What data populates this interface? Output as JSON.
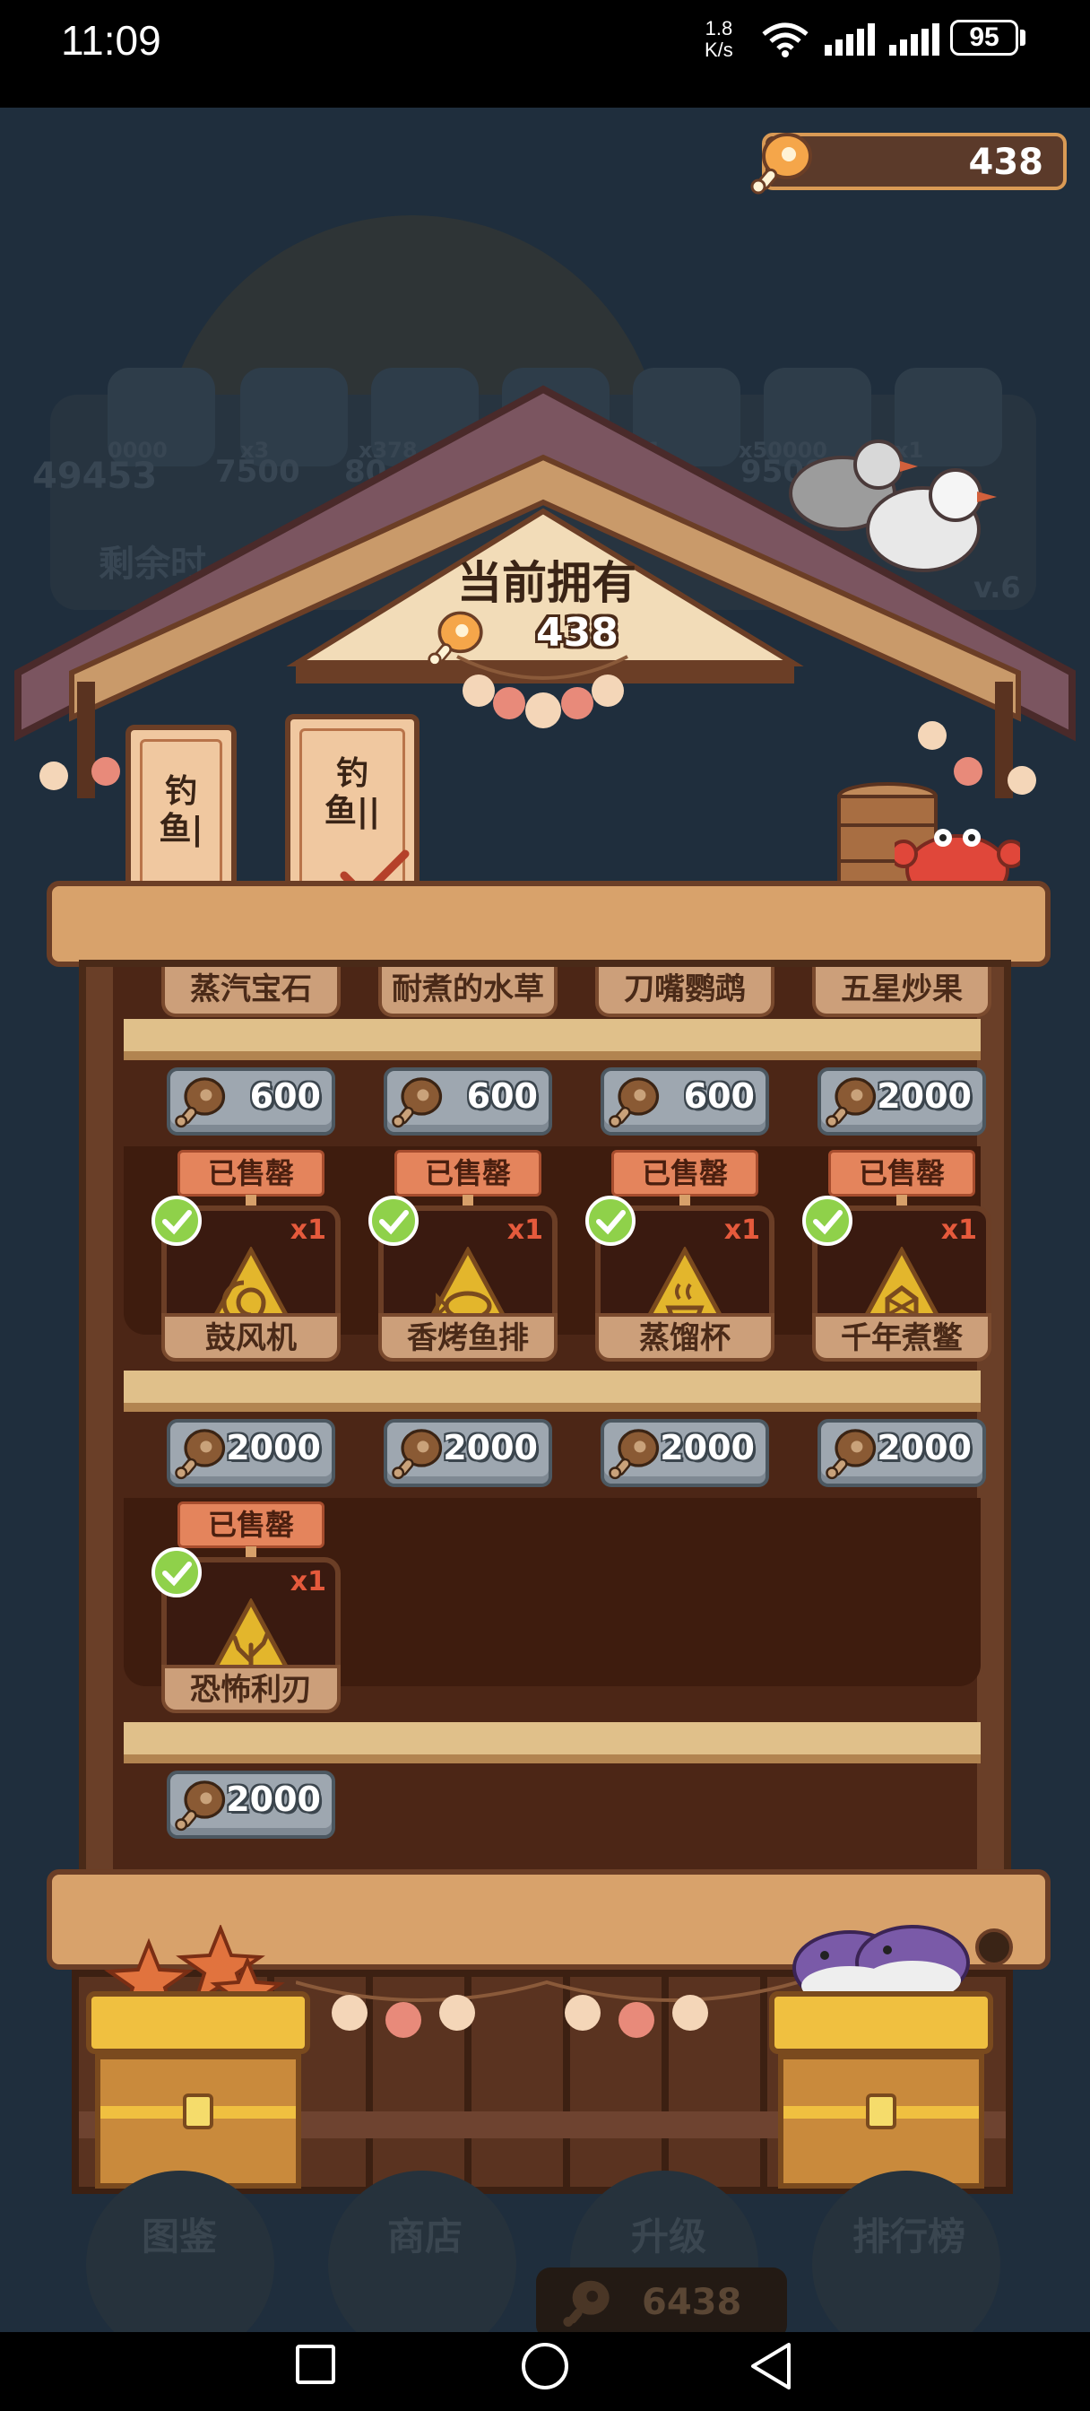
{
  "status_bar": {
    "time": "11:09",
    "net_speed_value": "1.8",
    "net_speed_unit": "K/s",
    "battery": "95"
  },
  "balance": {
    "value": "438",
    "icon": "drumstick-icon"
  },
  "shop": {
    "title": "当前拥有",
    "owned_value": "438",
    "tabs": [
      {
        "label_lines": [
          "钓",
          "鱼|"
        ],
        "selected": false
      },
      {
        "label_lines": [
          "钓",
          "鱼||"
        ],
        "selected": true
      }
    ],
    "row1": {
      "names": [
        "蒸汽宝石",
        "耐煮的水草",
        "刀嘴鹦鹉",
        "五星炒果"
      ],
      "prices": [
        "600",
        "600",
        "600",
        "2000"
      ]
    },
    "row2": {
      "sold_label": "已售罄",
      "items": [
        {
          "name": "鼓风机",
          "qty": "x1",
          "icon": "spiral-icon"
        },
        {
          "name": "香烤鱼排",
          "qty": "x1",
          "icon": "fish-icon"
        },
        {
          "name": "蒸馏杯",
          "qty": "x1",
          "icon": "steam-cup-icon"
        },
        {
          "name": "千年煮鳖",
          "qty": "x1",
          "icon": "turtle-icon"
        }
      ],
      "prices": [
        "2000",
        "2000",
        "2000",
        "2000"
      ]
    },
    "row3": {
      "sold_label": "已售罄",
      "items": [
        {
          "name": "恐怖利刃",
          "qty": "x1",
          "icon": "coral-icon"
        }
      ],
      "prices": [
        "2000"
      ]
    }
  },
  "background": {
    "bubbles": [
      "0000",
      "x3",
      "x378",
      "x3",
      "x1",
      "x50000",
      "x1"
    ],
    "score_left": "49453",
    "marks": [
      "7500",
      "80",
      "9500"
    ],
    "remaining_label": "剩余时",
    "level": "v.6"
  },
  "bottom_nav": {
    "items": [
      "图鉴",
      "商店",
      "升级",
      "排行榜"
    ],
    "fish_count": "6438"
  },
  "colors": {
    "wood": "#d8a26b",
    "dark_wood": "#6b3e26",
    "price_stone": "#9ea7b0",
    "sold_red": "#e4845c",
    "check_green": "#8fd14a"
  }
}
